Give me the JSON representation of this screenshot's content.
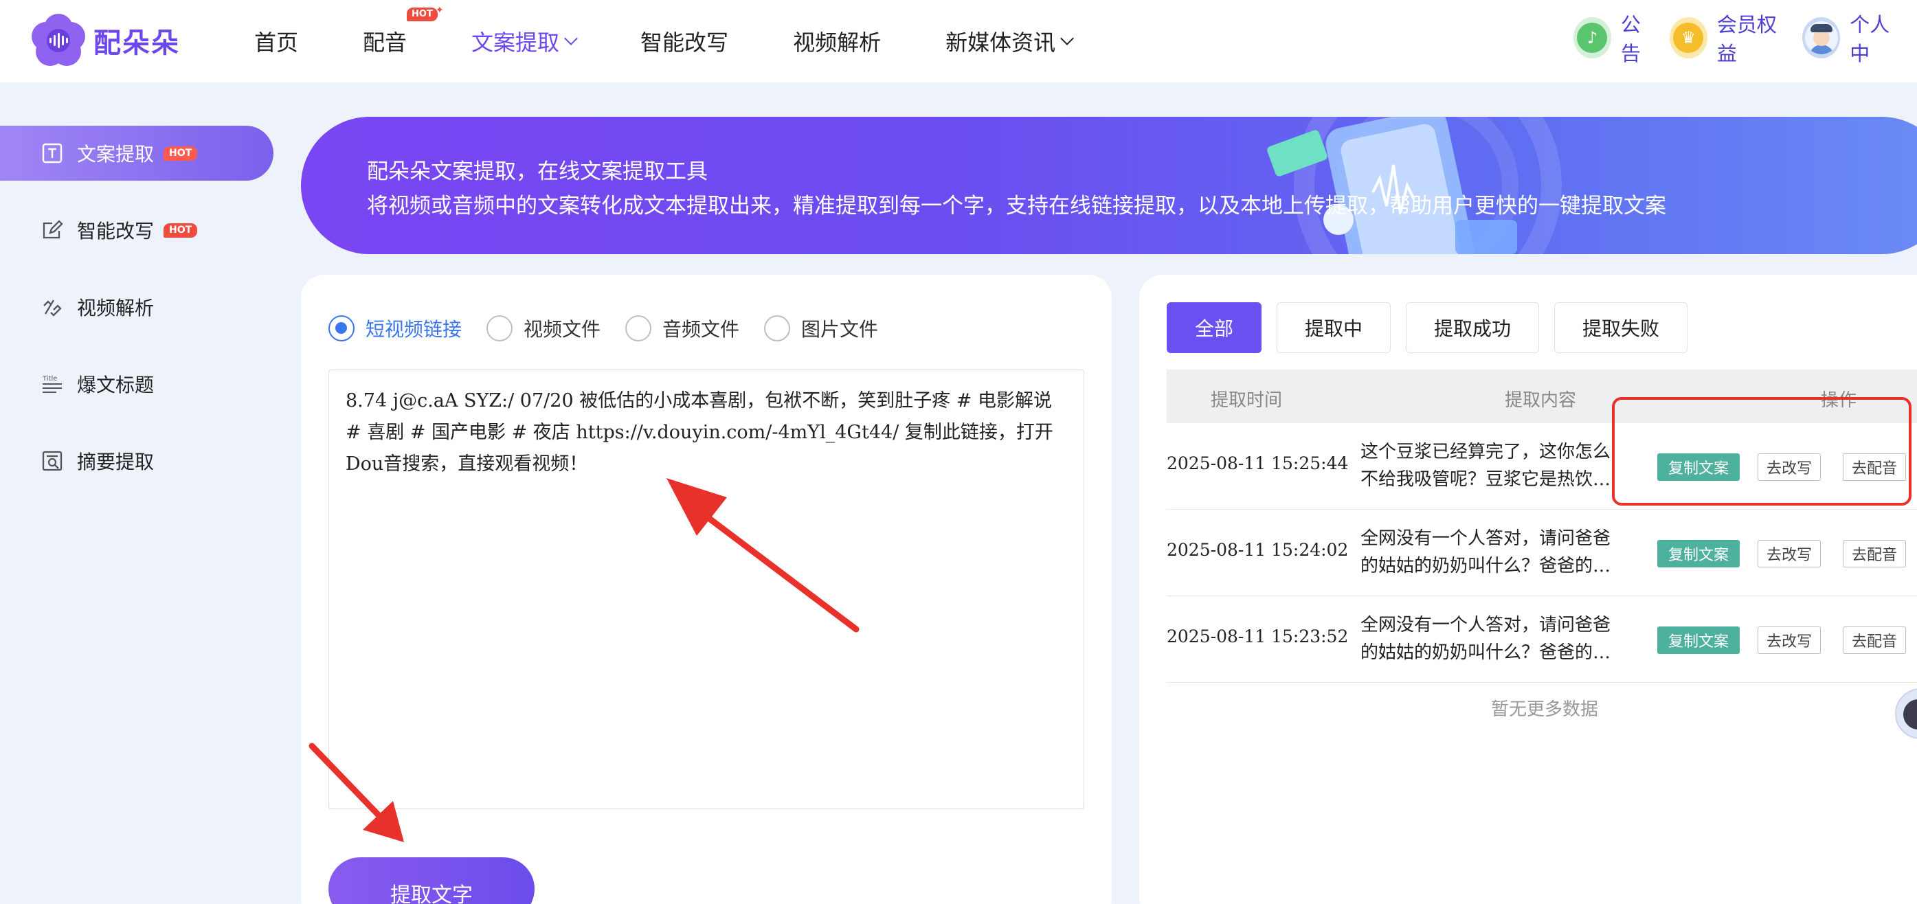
{
  "brand": {
    "name": "配朵朵",
    "accent": "#6c47ea"
  },
  "nav": {
    "items": [
      {
        "label": "首页"
      },
      {
        "label": "配音",
        "badge": "HOT"
      },
      {
        "label": "文案提取"
      },
      {
        "label": "智能改写"
      },
      {
        "label": "视频解析"
      },
      {
        "label": "新媒体资讯"
      }
    ]
  },
  "header_right": {
    "notice": "公告",
    "member": "会员权益",
    "profile": "个人中"
  },
  "sidebar": {
    "items": [
      {
        "label": "文案提取",
        "badge": "HOT",
        "icon": "text-box-icon"
      },
      {
        "label": "智能改写",
        "badge": "HOT",
        "icon": "edit-icon"
      },
      {
        "label": "视频解析",
        "icon": "video-link-icon"
      },
      {
        "label": "爆文标题",
        "icon": "title-icon"
      },
      {
        "label": "摘要提取",
        "icon": "summary-icon"
      }
    ]
  },
  "banner": {
    "title": "配朵朵文案提取，在线文案提取工具",
    "subtitle": "将视频或音频中的文案转化成文本提取出来，精准提取到每一个字，支持在线链接提取，以及本地上传提取，帮助用户更快的一键提取文案"
  },
  "extractor": {
    "source_types": [
      "短视频链接",
      "视频文件",
      "音频文件",
      "图片文件"
    ],
    "selected_type": "短视频链接",
    "input_value": "8.74 j@c.aA SYZ:/ 07/20 被低估的小成本喜剧，包袱不断，笑到肚子疼 # 电影解说 # 喜剧 # 国产电影 # 夜店  https://v.douyin.com/-4mYl_4Gt44/ 复制此链接，打开Dou音搜索，直接观看视频！",
    "submit_label": "提取文字"
  },
  "history": {
    "tabs": [
      "全部",
      "提取中",
      "提取成功",
      "提取失败"
    ],
    "active_tab": "全部",
    "columns": [
      "提取时间",
      "提取内容",
      "操作"
    ],
    "rows": [
      {
        "time": "2025-08-11 15:25:44",
        "line1": "这个豆浆已经算完了，这你怎么",
        "line2": "不给我吸管呢？豆浆它是热饮…"
      },
      {
        "time": "2025-08-11 15:24:02",
        "line1": "全网没有一个人答对，请问爸爸",
        "line2": "的姑姑的奶奶叫什么？爸爸的…"
      },
      {
        "time": "2025-08-11 15:23:52",
        "line1": "全网没有一个人答对，请问爸爸",
        "line2": "的姑姑的奶奶叫什么？爸爸的…"
      }
    ],
    "actions": {
      "copy": "复制文案",
      "rewrite": "去改写",
      "dub": "去配音"
    },
    "empty_text": "暂无更多数据"
  },
  "colors": {
    "primary": "#6b4ff0",
    "copy_button": "#4eb19e",
    "radio_selected": "#3a76f0",
    "annotation_red": "#e8312a"
  }
}
